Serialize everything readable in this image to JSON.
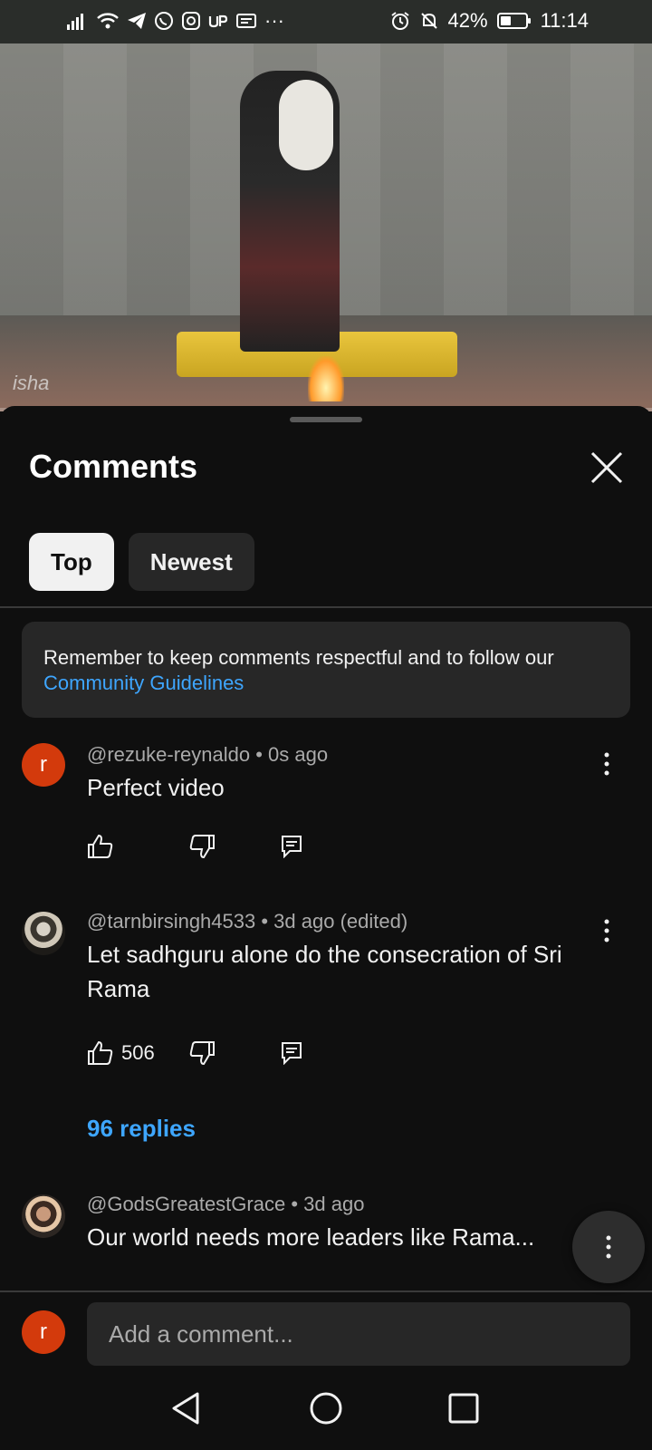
{
  "status_bar": {
    "battery": "42%",
    "battery_level": 0.42,
    "time": "11:14",
    "overflow": "···"
  },
  "video": {
    "watermark": "isha"
  },
  "comments_panel": {
    "title": "Comments",
    "chips": [
      {
        "label": "Top",
        "selected": true
      },
      {
        "label": "Newest",
        "selected": false
      }
    ],
    "notice": {
      "text": "Remember to keep comments respectful and to follow our ",
      "link": "Community Guidelines"
    },
    "comments": [
      {
        "avatar_letter": "r",
        "author": "@rezuke-reynaldo",
        "time": "0s ago",
        "text": "Perfect video",
        "likes": ""
      },
      {
        "author": "@tarnbirsingh4533",
        "time": "3d ago (edited)",
        "text": "Let sadhguru alone do the consecration of Sri Rama",
        "likes": "506",
        "replies": "96 replies"
      },
      {
        "author": "@GodsGreatestGrace",
        "time": "3d ago",
        "text": "Our world needs more leaders like Rama..."
      }
    ],
    "add_comment": {
      "avatar_letter": "r",
      "placeholder": "Add a comment..."
    }
  },
  "colors": {
    "background": "#0f0f0f",
    "surface": "#272727",
    "link": "#3ea6ff",
    "avatar": "#d33a0c",
    "secondary_text": "#aaaaaa"
  }
}
